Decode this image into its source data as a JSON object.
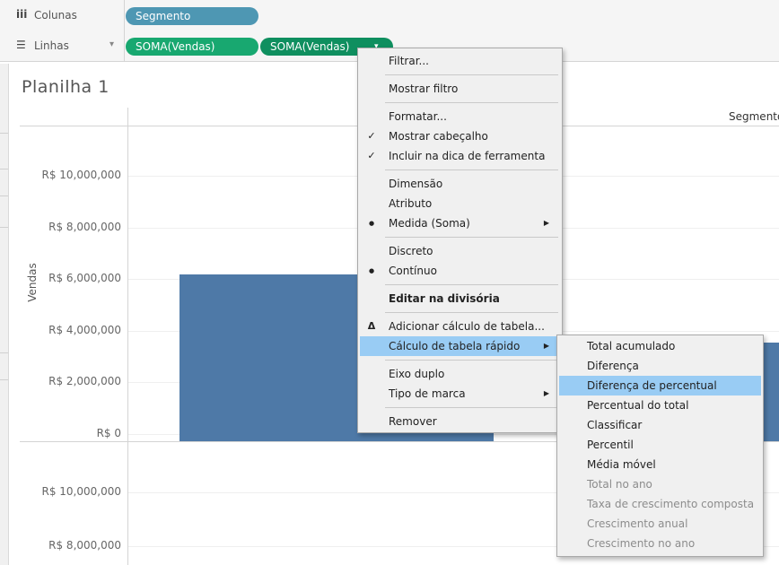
{
  "shelves": {
    "columns": {
      "icon": "iii",
      "label": "Colunas",
      "pills": [
        "Segmento"
      ]
    },
    "rows": {
      "icon": "☰",
      "label": "Linhas",
      "dropdown": "▾",
      "pills": [
        "SOMA(Vendas)",
        "SOMA(Vendas)"
      ]
    }
  },
  "sheet": {
    "title": "Planilha 1"
  },
  "chart_data": {
    "type": "bar",
    "ylabel": "Vendas",
    "column_header": "Segmento",
    "panes": [
      {
        "ticks": [
          "R$ 10,000,000",
          "R$ 8,000,000",
          "R$ 6,000,000",
          "R$ 4,000,000",
          "R$ 2,000,000",
          "R$ 0"
        ],
        "tick_values": [
          10000000,
          8000000,
          6000000,
          4000000,
          2000000,
          0
        ],
        "ylim": [
          0,
          11600000
        ]
      },
      {
        "ticks": [
          "R$ 10,000,000",
          "R$ 8,000,000"
        ],
        "tick_values": [
          10000000,
          8000000
        ]
      }
    ],
    "values": [
      6450000,
      3820000
    ],
    "color": "#4e79a7"
  },
  "context_menu": {
    "items": [
      {
        "type": "item",
        "label": "Filtrar..."
      },
      {
        "type": "sep"
      },
      {
        "type": "item",
        "label": "Mostrar filtro"
      },
      {
        "type": "sep"
      },
      {
        "type": "item",
        "label": "Formatar..."
      },
      {
        "type": "item",
        "label": "Mostrar cabeçalho",
        "mark": "✓"
      },
      {
        "type": "item",
        "label": "Incluir na dica de ferramenta",
        "mark": "✓"
      },
      {
        "type": "sep"
      },
      {
        "type": "item",
        "label": "Dimensão"
      },
      {
        "type": "item",
        "label": "Atributo"
      },
      {
        "type": "item",
        "label": "Medida (Soma)",
        "mark": "●",
        "submenu": "▶"
      },
      {
        "type": "sep"
      },
      {
        "type": "item",
        "label": "Discreto"
      },
      {
        "type": "item",
        "label": "Contínuo",
        "mark": "●"
      },
      {
        "type": "sep"
      },
      {
        "type": "item",
        "label": "Editar na divisória",
        "bold": true
      },
      {
        "type": "sep"
      },
      {
        "type": "item",
        "label": "Adicionar cálculo de tabela...",
        "mark": "Δ"
      },
      {
        "type": "item",
        "label": "Cálculo de tabela rápido",
        "submenu": "▶",
        "highlight": true
      },
      {
        "type": "sep"
      },
      {
        "type": "item",
        "label": "Eixo duplo"
      },
      {
        "type": "item",
        "label": "Tipo de marca",
        "submenu": "▶"
      },
      {
        "type": "sep"
      },
      {
        "type": "item",
        "label": "Remover"
      }
    ]
  },
  "submenu": {
    "items": [
      {
        "label": "Total acumulado"
      },
      {
        "label": "Diferença"
      },
      {
        "label": "Diferença de percentual",
        "highlight": true
      },
      {
        "label": "Percentual do total"
      },
      {
        "label": "Classificar"
      },
      {
        "label": "Percentil"
      },
      {
        "label": "Média móvel"
      },
      {
        "label": "Total no ano",
        "disabled": true
      },
      {
        "label": "Taxa de crescimento composta",
        "disabled": true
      },
      {
        "label": "Crescimento anual",
        "disabled": true
      },
      {
        "label": "Crescimento no ano",
        "disabled": true
      }
    ]
  }
}
